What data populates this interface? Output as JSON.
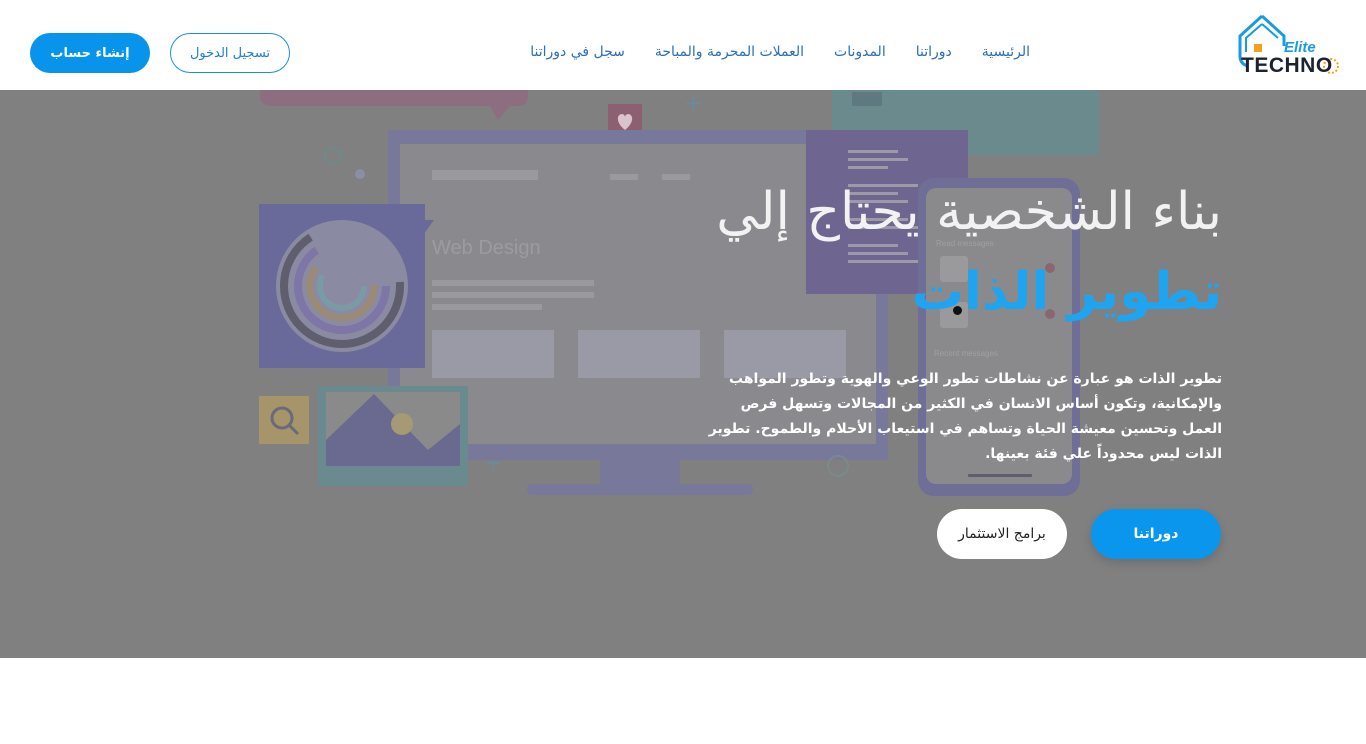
{
  "brand": {
    "logo_top": "Elite",
    "logo_bottom": "TECHNO"
  },
  "nav": {
    "items": [
      {
        "label": "الرئيسية"
      },
      {
        "label": "دوراتنا"
      },
      {
        "label": "المدونات"
      },
      {
        "label": "العملات المحرمة والمباحة"
      },
      {
        "label": "سجل في دوراتنا"
      }
    ]
  },
  "auth": {
    "login_label": "تسجيل الدخول",
    "signup_label": "إنشاء حساب"
  },
  "hero": {
    "title_line1": "بناء الشخصية يحتاج إلي",
    "title_line2": "تطوير الذات",
    "description": "تطوير الذات هو عبارة عن نشاطات تطور الوعي والهوية وتطور المواهب والإمكانية، وتكون أساس الانسان في الكثير من المجالات وتسهل فرص العمل وتحسين معيشة الحياة وتساهم في استيعاب الأحلام والطموح. تطوير الذات ليس محدوداً علي فئة بعينها.",
    "primary_button": "دوراتنا",
    "secondary_button": "برامج الاستثمار",
    "illustration_text": "Web Design",
    "illustration_list_title": "Read messages",
    "illustration_list_title_2": "Recent messages"
  },
  "colors": {
    "accent": "#0794ea",
    "hero_overlay": "#808080",
    "nav_text": "#2a6fb8"
  }
}
